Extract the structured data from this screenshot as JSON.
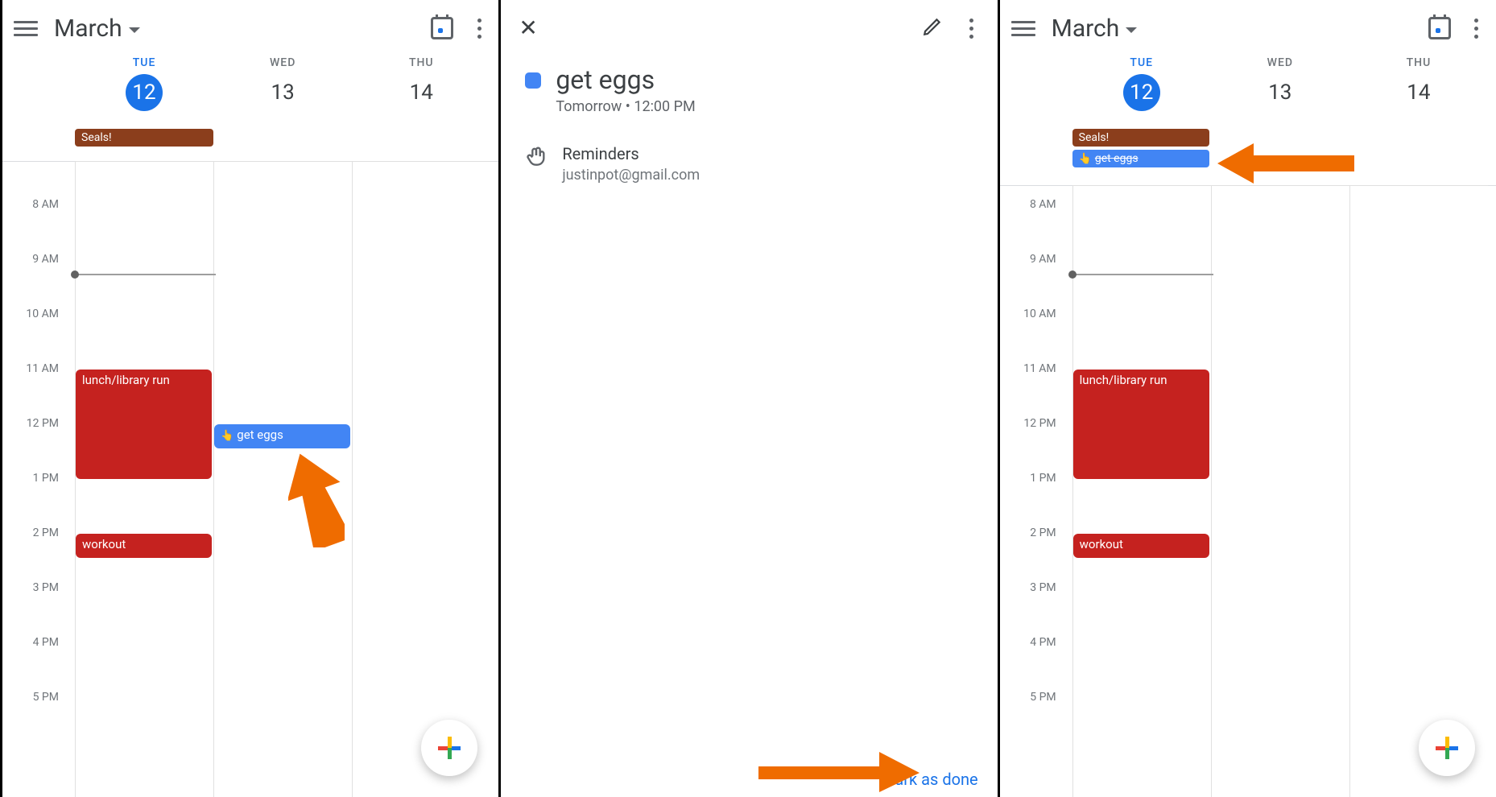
{
  "calendar": {
    "month_label": "March",
    "days": [
      {
        "dow": "TUE",
        "num": "12",
        "today": true
      },
      {
        "dow": "WED",
        "num": "13",
        "today": false
      },
      {
        "dow": "THU",
        "num": "14",
        "today": false
      }
    ],
    "hours": [
      "8 AM",
      "9 AM",
      "10 AM",
      "11 AM",
      "12 PM",
      "1 PM",
      "2 PM",
      "3 PM",
      "4 PM",
      "5 PM"
    ],
    "allday_event": {
      "title": "Seals!"
    },
    "events": {
      "lunch": {
        "title": "lunch/library run"
      },
      "workout": {
        "title": "workout"
      },
      "get_eggs": {
        "title": "get eggs"
      }
    }
  },
  "detail": {
    "title": "get eggs",
    "subtitle": "Tomorrow  •  12:00 PM",
    "account_label": "Reminders",
    "account_email": "justinpot@gmail.com",
    "mark_done": "Mark as done"
  }
}
